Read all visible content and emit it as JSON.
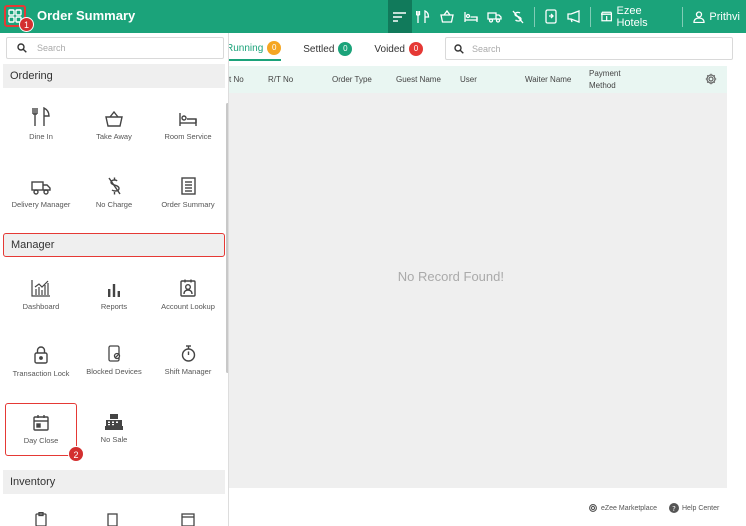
{
  "header": {
    "title": "Order Summary",
    "callout_1": "1",
    "hotel": "Ezee Hotels",
    "user": "Prithvi",
    "icons": [
      "filter-icon",
      "dine-in-icon",
      "take-away-icon",
      "room-service-icon",
      "delivery-icon",
      "no-charge-icon",
      "blocked-device-icon",
      "announcement-icon",
      "hotel-icon",
      "user-icon"
    ]
  },
  "sidebar": {
    "search_placeholder": "Search",
    "sections": {
      "ordering": "Ordering",
      "manager": "Manager",
      "inventory": "Inventory"
    },
    "ordering_items": [
      {
        "label": "Dine In",
        "icon": "dine-in-icon"
      },
      {
        "label": "Take Away",
        "icon": "basket-icon"
      },
      {
        "label": "Room Service",
        "icon": "bed-icon"
      },
      {
        "label": "Delivery Manager",
        "icon": "truck-icon"
      },
      {
        "label": "No Charge",
        "icon": "no-charge-icon"
      },
      {
        "label": "Order Summary",
        "icon": "receipt-icon"
      }
    ],
    "manager_items": [
      {
        "label": "Dashboard",
        "icon": "dashboard-icon"
      },
      {
        "label": "Reports",
        "icon": "bar-chart-icon"
      },
      {
        "label": "Account Lookup",
        "icon": "account-icon"
      },
      {
        "label": "Transaction Lock",
        "icon": "lock-icon"
      },
      {
        "label": "Blocked Devices",
        "icon": "blocked-device-icon"
      },
      {
        "label": "Shift Manager",
        "icon": "stopwatch-icon"
      },
      {
        "label": "Day Close",
        "icon": "calendar-icon"
      },
      {
        "label": "No Sale",
        "icon": "cash-register-icon"
      }
    ],
    "callout_2": "2"
  },
  "main": {
    "tabs": [
      {
        "label": "Running",
        "count": "0",
        "color": "#f5a623"
      },
      {
        "label": "Settled",
        "count": "0",
        "color": "#1ba37a"
      },
      {
        "label": "Voided",
        "count": "0",
        "color": "#e53935"
      }
    ],
    "search_placeholder": "Search",
    "columns": [
      "t No",
      "R/T No",
      "Order Type",
      "Guest Name",
      "User",
      "Waiter Name",
      "Payment Method"
    ],
    "empty_text": "No Record Found!"
  },
  "footer": {
    "marketplace": "eZee Marketplace",
    "help": "Help Center"
  },
  "colors": {
    "brand": "#1ba37a",
    "highlight": "#e53935"
  }
}
